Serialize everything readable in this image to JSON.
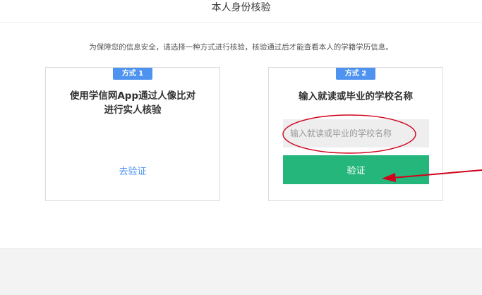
{
  "header": {
    "title": "本人身份核验"
  },
  "notice": "为保障您的信息安全，请选择一种方式进行核验，核验通过后才能查看本人的学籍学历信息。",
  "methods": [
    {
      "badge": "方式 1",
      "title_line1": "使用学信网App通过人像比对",
      "title_line2": "进行实人核验",
      "link_label": "去验证"
    },
    {
      "badge": "方式 2",
      "title": "输入就读或毕业的学校名称",
      "input_placeholder": "输入就读或毕业的学校名称",
      "input_value": "",
      "button_label": "验证"
    }
  ],
  "colors": {
    "accent_blue": "#4f93f0",
    "verify_green": "#25b67b",
    "annotation_red": "#d0021b"
  }
}
